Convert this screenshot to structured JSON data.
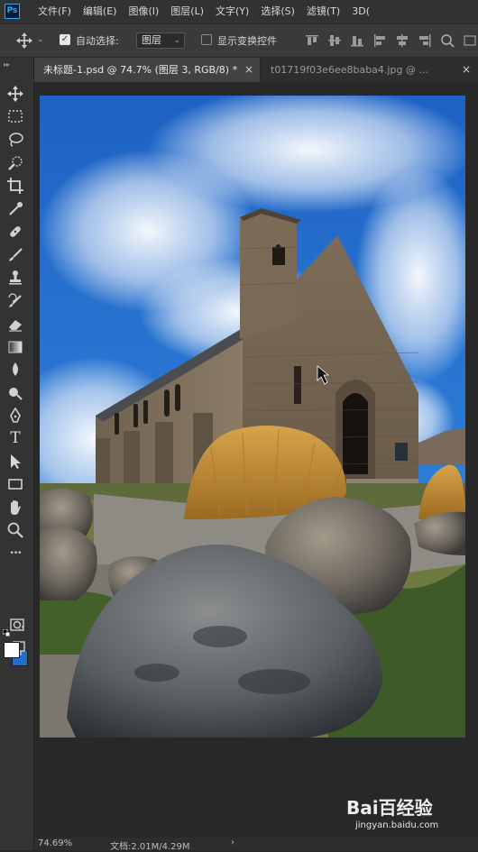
{
  "app": {
    "logo_text": "Ps",
    "brand_color": "#31a8ff"
  },
  "menu": [
    "文件(F)",
    "编辑(E)",
    "图像(I)",
    "图层(L)",
    "文字(Y)",
    "选择(S)",
    "滤镜(T)",
    "3D("
  ],
  "options_bar": {
    "tool_icon": "move-icon",
    "auto_select_label": "自动选择:",
    "auto_select_checked": true,
    "layer_select_value": "图层",
    "transform_controls_label": "显示变换控件",
    "transform_controls_checked": false,
    "align_icons": [
      "align-top-icon",
      "align-vcenter-icon",
      "align-bottom-icon",
      "align-left-icon",
      "align-hcenter-icon",
      "align-right-icon",
      "search-icon",
      "ellipsis-icon"
    ]
  },
  "tabs": [
    {
      "label": "未标题-1.psd @ 74.7% (图层 3, RGB/8) *",
      "active": true,
      "close": "×"
    },
    {
      "label": "t01719f03e6ee8baba4.jpg @ ...",
      "active": false,
      "close": "×"
    }
  ],
  "tools": [
    "move-icon",
    "marquee-icon",
    "lasso-icon",
    "quick-select-icon",
    "crop-icon",
    "eyedropper-icon",
    "healing-brush-icon",
    "brush-icon",
    "clone-stamp-icon",
    "history-brush-icon",
    "eraser-icon",
    "gradient-icon",
    "blur-icon",
    "dodge-icon",
    "pen-icon",
    "type-icon",
    "path-select-icon",
    "rectangle-icon",
    "hand-icon",
    "zoom-icon",
    "more-icon"
  ],
  "type_tool_glyph": "T",
  "more_tools_glyph": "•••",
  "colors": {
    "foreground": "#ffffff",
    "background": "#1f6fcf"
  },
  "status": {
    "zoom": "74.69%",
    "doc": "文档:2.01M/4.29M",
    "arrow": "›"
  },
  "watermark": {
    "logo": "Bai百经验",
    "site": "jingyan.baidu.com"
  }
}
